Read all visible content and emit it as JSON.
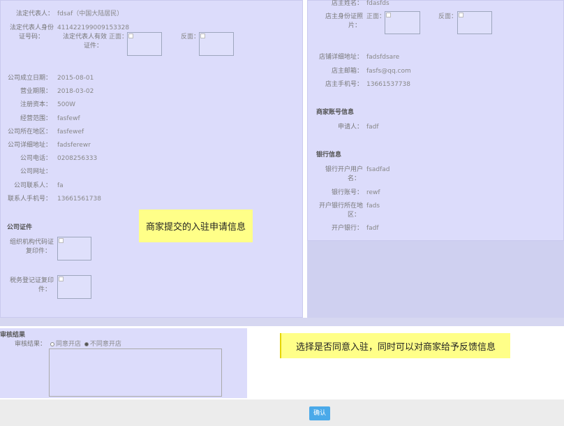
{
  "left": {
    "legal_rep_label": "法定代表人：",
    "legal_rep_value": "fdsaf（中国大陆居民）",
    "id_label_1": "法定代表人身份",
    "id_label_2": "证号码：",
    "id_value": "411422199009153328",
    "id_photo_label_1": "法定代表人有效",
    "id_photo_label_2": "证件：",
    "front_label": "正面：",
    "back_label": "反面：",
    "fields": [
      {
        "label": "公司成立日期：",
        "value": "2015-08-01"
      },
      {
        "label": "营业期限：",
        "value": "2018-03-02"
      },
      {
        "label": "注册资本：",
        "value": "500W"
      },
      {
        "label": "经营范围：",
        "value": "fasfewf"
      },
      {
        "label": "公司所在地区：",
        "value": "fasfewef"
      },
      {
        "label": "公司详细地址：",
        "value": "fadsferewr"
      },
      {
        "label": "公司电话：",
        "value": "0208256333"
      },
      {
        "label": "公司网址：",
        "value": ""
      },
      {
        "label": "公司联系人：",
        "value": "fa"
      },
      {
        "label": "联系人手机号：",
        "value": "13661561738"
      }
    ],
    "cert_section": "公司证件",
    "org_code_1": "组织机构代码证",
    "org_code_2": "复印件：",
    "tax_1": "税务登记证复印",
    "tax_2": "件："
  },
  "right": {
    "owner_name_label": "店主姓名：",
    "owner_name_value": "fdasfds",
    "owner_id_label_1": "店主身份证照",
    "owner_id_label_2": "片：",
    "front_label": "正面：",
    "back_label": "反面：",
    "fields": [
      {
        "label": "店铺详细地址：",
        "value": "fadsfdsare"
      },
      {
        "label": "店主邮箱：",
        "value": "fasfs@qq.com"
      },
      {
        "label": "店主手机号：",
        "value": "13661537738"
      }
    ],
    "account_section": "商家账号信息",
    "applicant_label": "申请人：",
    "applicant_value": "fadf",
    "bank_section": "银行信息",
    "bank_user_label_1": "银行开户用户",
    "bank_user_label_2": "名：",
    "bank_user_value": "fsadfad",
    "bank_account_label": "银行账号：",
    "bank_account_value": "rewf",
    "bank_region_label_1": "开户银行所在地",
    "bank_region_label_2": "区：",
    "bank_region_value": "fads",
    "bank_name_label": "开户银行：",
    "bank_name_value": "fadf"
  },
  "notes": {
    "merchant_info": "商家提交的入驻申请信息",
    "review_hint": "选择是否同意入驻，同时可以对商家给予反馈信息"
  },
  "review": {
    "section": "审核结果",
    "label": "审核结果：",
    "agree": "同意开店",
    "disagree": "不同意开店",
    "selected": "disagree"
  },
  "confirm_button": "确认"
}
